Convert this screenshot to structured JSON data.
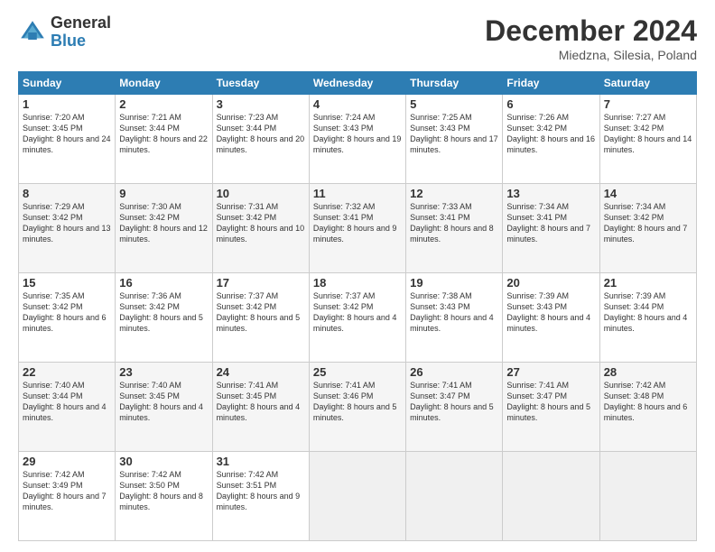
{
  "logo": {
    "general": "General",
    "blue": "Blue"
  },
  "title": "December 2024",
  "location": "Miedzna, Silesia, Poland",
  "days_of_week": [
    "Sunday",
    "Monday",
    "Tuesday",
    "Wednesday",
    "Thursday",
    "Friday",
    "Saturday"
  ],
  "weeks": [
    [
      {
        "day": "1",
        "sunrise": "7:20 AM",
        "sunset": "3:45 PM",
        "daylight": "8 hours and 24 minutes."
      },
      {
        "day": "2",
        "sunrise": "7:21 AM",
        "sunset": "3:44 PM",
        "daylight": "8 hours and 22 minutes."
      },
      {
        "day": "3",
        "sunrise": "7:23 AM",
        "sunset": "3:44 PM",
        "daylight": "8 hours and 20 minutes."
      },
      {
        "day": "4",
        "sunrise": "7:24 AM",
        "sunset": "3:43 PM",
        "daylight": "8 hours and 19 minutes."
      },
      {
        "day": "5",
        "sunrise": "7:25 AM",
        "sunset": "3:43 PM",
        "daylight": "8 hours and 17 minutes."
      },
      {
        "day": "6",
        "sunrise": "7:26 AM",
        "sunset": "3:42 PM",
        "daylight": "8 hours and 16 minutes."
      },
      {
        "day": "7",
        "sunrise": "7:27 AM",
        "sunset": "3:42 PM",
        "daylight": "8 hours and 14 minutes."
      }
    ],
    [
      {
        "day": "8",
        "sunrise": "7:29 AM",
        "sunset": "3:42 PM",
        "daylight": "8 hours and 13 minutes."
      },
      {
        "day": "9",
        "sunrise": "7:30 AM",
        "sunset": "3:42 PM",
        "daylight": "8 hours and 12 minutes."
      },
      {
        "day": "10",
        "sunrise": "7:31 AM",
        "sunset": "3:42 PM",
        "daylight": "8 hours and 10 minutes."
      },
      {
        "day": "11",
        "sunrise": "7:32 AM",
        "sunset": "3:41 PM",
        "daylight": "8 hours and 9 minutes."
      },
      {
        "day": "12",
        "sunrise": "7:33 AM",
        "sunset": "3:41 PM",
        "daylight": "8 hours and 8 minutes."
      },
      {
        "day": "13",
        "sunrise": "7:34 AM",
        "sunset": "3:41 PM",
        "daylight": "8 hours and 7 minutes."
      },
      {
        "day": "14",
        "sunrise": "7:34 AM",
        "sunset": "3:42 PM",
        "daylight": "8 hours and 7 minutes."
      }
    ],
    [
      {
        "day": "15",
        "sunrise": "7:35 AM",
        "sunset": "3:42 PM",
        "daylight": "8 hours and 6 minutes."
      },
      {
        "day": "16",
        "sunrise": "7:36 AM",
        "sunset": "3:42 PM",
        "daylight": "8 hours and 5 minutes."
      },
      {
        "day": "17",
        "sunrise": "7:37 AM",
        "sunset": "3:42 PM",
        "daylight": "8 hours and 5 minutes."
      },
      {
        "day": "18",
        "sunrise": "7:37 AM",
        "sunset": "3:42 PM",
        "daylight": "8 hours and 4 minutes."
      },
      {
        "day": "19",
        "sunrise": "7:38 AM",
        "sunset": "3:43 PM",
        "daylight": "8 hours and 4 minutes."
      },
      {
        "day": "20",
        "sunrise": "7:39 AM",
        "sunset": "3:43 PM",
        "daylight": "8 hours and 4 minutes."
      },
      {
        "day": "21",
        "sunrise": "7:39 AM",
        "sunset": "3:44 PM",
        "daylight": "8 hours and 4 minutes."
      }
    ],
    [
      {
        "day": "22",
        "sunrise": "7:40 AM",
        "sunset": "3:44 PM",
        "daylight": "8 hours and 4 minutes."
      },
      {
        "day": "23",
        "sunrise": "7:40 AM",
        "sunset": "3:45 PM",
        "daylight": "8 hours and 4 minutes."
      },
      {
        "day": "24",
        "sunrise": "7:41 AM",
        "sunset": "3:45 PM",
        "daylight": "8 hours and 4 minutes."
      },
      {
        "day": "25",
        "sunrise": "7:41 AM",
        "sunset": "3:46 PM",
        "daylight": "8 hours and 5 minutes."
      },
      {
        "day": "26",
        "sunrise": "7:41 AM",
        "sunset": "3:47 PM",
        "daylight": "8 hours and 5 minutes."
      },
      {
        "day": "27",
        "sunrise": "7:41 AM",
        "sunset": "3:47 PM",
        "daylight": "8 hours and 5 minutes."
      },
      {
        "day": "28",
        "sunrise": "7:42 AM",
        "sunset": "3:48 PM",
        "daylight": "8 hours and 6 minutes."
      }
    ],
    [
      {
        "day": "29",
        "sunrise": "7:42 AM",
        "sunset": "3:49 PM",
        "daylight": "8 hours and 7 minutes."
      },
      {
        "day": "30",
        "sunrise": "7:42 AM",
        "sunset": "3:50 PM",
        "daylight": "8 hours and 8 minutes."
      },
      {
        "day": "31",
        "sunrise": "7:42 AM",
        "sunset": "3:51 PM",
        "daylight": "8 hours and 9 minutes."
      },
      null,
      null,
      null,
      null
    ]
  ]
}
